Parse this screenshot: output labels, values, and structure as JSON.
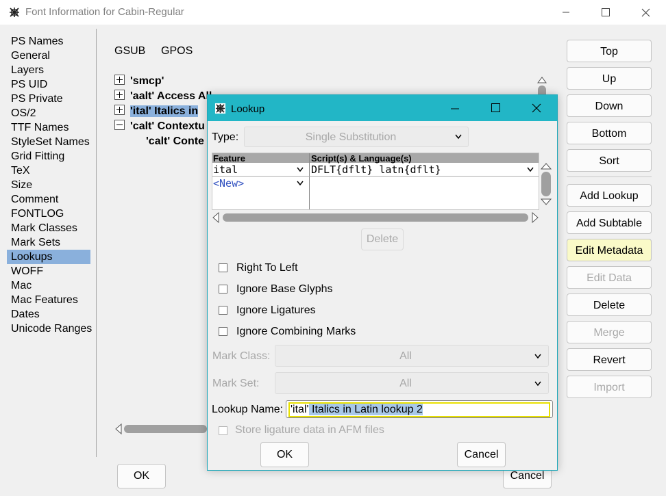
{
  "window": {
    "title": "Font Information for Cabin-Regular",
    "icon": "fontforge-icon"
  },
  "categories": [
    "PS Names",
    "General",
    "Layers",
    "PS UID",
    "PS Private",
    "OS/2",
    "TTF Names",
    "StyleSet Names",
    "Grid Fitting",
    "TeX",
    "Size",
    "Comment",
    "FONTLOG",
    "Mark Classes",
    "Mark Sets",
    "Lookups",
    "WOFF",
    "Mac",
    "Mac Features",
    "Dates",
    "Unicode Ranges"
  ],
  "selected_category": "Lookups",
  "tabs": {
    "gsub": "GSUB",
    "gpos": "GPOS"
  },
  "tree": {
    "row1": "'smcp'",
    "row2": "'aalt' Access All",
    "row3": "'ital' Italics in",
    "row4": "'calt' Contextu",
    "row5": "'calt' Conte"
  },
  "side_buttons": {
    "top": "Top",
    "up": "Up",
    "down": "Down",
    "bottom": "Bottom",
    "sort": "Sort",
    "add_lookup": "Add Lookup",
    "add_subtable": "Add Subtable",
    "edit_metadata": "Edit Metadata",
    "edit_data": "Edit Data",
    "delete": "Delete",
    "merge": "Merge",
    "revert": "Revert",
    "import": "Import"
  },
  "main_ok": "OK",
  "main_cancel": "Cancel",
  "dialog": {
    "title": "Lookup",
    "type_label": "Type:",
    "type_value": "Single Substitution",
    "col_feature": "Feature",
    "col_script": "Script(s) & Language(s)",
    "row_feature": "ital",
    "row_script": "DFLT{dflt} latn{dflt}",
    "row_new": "<New>",
    "delete": "Delete",
    "checks": {
      "rtl": "Right To Left",
      "ignore_base": "Ignore Base Glyphs",
      "ignore_lig": "Ignore Ligatures",
      "ignore_marks": "Ignore Combining Marks"
    },
    "mark_class_label": "Mark Class:",
    "mark_class_value": "All",
    "mark_set_label": "Mark Set:",
    "mark_set_value": "All",
    "lookup_name_label": "Lookup Name:",
    "lookup_name_quote": "'ital'",
    "lookup_name_rest": " Italics in Latin lookup 2",
    "store_lig": "Store ligature data in AFM files",
    "ok": "OK",
    "cancel": "Cancel"
  }
}
